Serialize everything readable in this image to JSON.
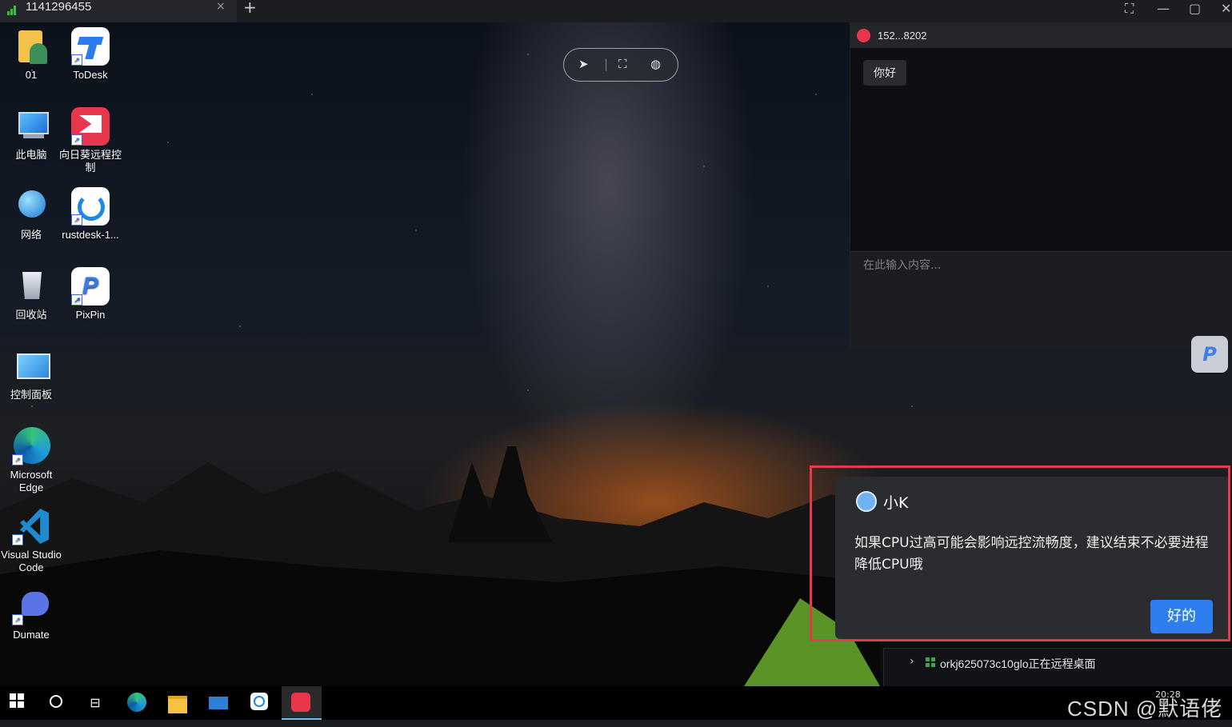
{
  "tab": {
    "title": "1141296455",
    "close": "×",
    "new": "+"
  },
  "window_controls": {
    "fullscreen": "⛶",
    "minimize": "—",
    "maximize": "▢",
    "close": "✕"
  },
  "desktop_icons": [
    {
      "label": "01"
    },
    {
      "label": "ToDesk"
    },
    {
      "label": "此电脑"
    },
    {
      "label": "向日葵远程控制"
    },
    {
      "label": "网络"
    },
    {
      "label": "rustdesk-1..."
    },
    {
      "label": "回收站"
    },
    {
      "label": "PixPin"
    },
    {
      "label": "控制面板"
    },
    {
      "label": "Microsoft Edge"
    },
    {
      "label": "Visual Studio Code"
    },
    {
      "label": "Dumate"
    }
  ],
  "chat": {
    "peer": "152...8202",
    "message": "你好",
    "input_placeholder": "在此输入内容..."
  },
  "dialog": {
    "name": "小K",
    "message": "如果CPU过高可能会影响远控流畅度，建议结束不必要进程降低CPU哦",
    "ok_label": "好的"
  },
  "session_status": "orkj625073c10glo正在远程桌面",
  "pin_button": "P",
  "watermark": "CSDN @默语佬",
  "clock_time": "20:28",
  "colors": {
    "accent_blue": "#2d7ff0",
    "highlight_red": "#e23c4b",
    "signal_green": "#31c43a"
  }
}
